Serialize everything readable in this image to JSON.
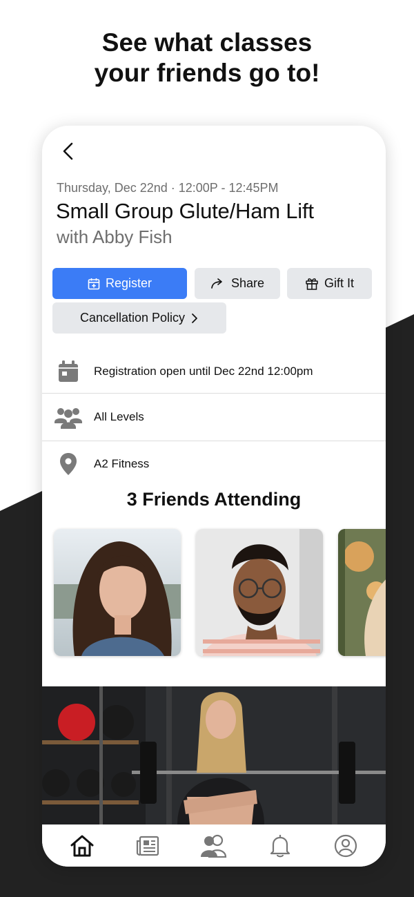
{
  "promo": {
    "headline_line1": "See what classes",
    "headline_line2": "your friends go to!"
  },
  "class_detail": {
    "date_time": "Thursday, Dec 22nd · 12:00P - 12:45PM",
    "title": "Small Group Glute/Ham Lift",
    "instructor": "with Abby Fish"
  },
  "actions": {
    "register_label": "Register",
    "share_label": "Share",
    "gift_label": "Gift It",
    "cancellation_label": "Cancellation Policy"
  },
  "info": [
    {
      "icon": "calendar-icon",
      "text": "Registration open until Dec 22nd 12:00pm"
    },
    {
      "icon": "people-icon",
      "text": "All Levels"
    },
    {
      "icon": "location-pin-icon",
      "text": "A2 Fitness"
    }
  ],
  "friends": {
    "title": "3 Friends Attending"
  },
  "tabbar": {
    "items": [
      "home-icon",
      "news-icon",
      "friends-icon",
      "bell-icon",
      "profile-icon"
    ]
  },
  "colors": {
    "accent": "#3b7cf6",
    "button_gray": "#e6e8eb",
    "dark_background": "#222222"
  }
}
